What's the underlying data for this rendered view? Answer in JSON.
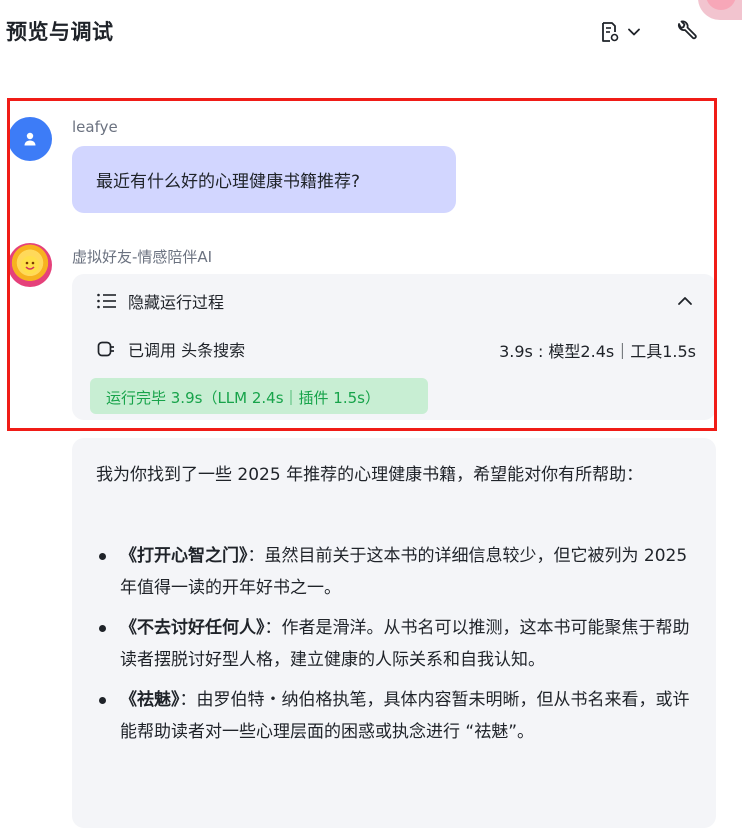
{
  "header": {
    "title": "预览与调试",
    "translate_badge": "A"
  },
  "messages": {
    "user": {
      "name": "leafye",
      "text": "最近有什么好的心理健康书籍推荐?"
    },
    "bot": {
      "name": "虚拟好友-情感陪伴AI",
      "process": {
        "toggle_label": "隐藏运行过程",
        "tool_used": "已调用 头条搜索",
        "timing": "3.9s : 模型2.4s｜工具1.5s",
        "done_badge": "运行完毕 3.9s（LLM 2.4s｜插件 1.5s）"
      },
      "answer": {
        "intro": "我为你找到了一些 2025 年推荐的心理健康书籍，希望能对你有所帮助：",
        "books": [
          {
            "title": "《打开心智之门》",
            "desc": "：虽然目前关于这本书的详细信息较少，但它被列为 2025 年值得一读的开年好书之一。"
          },
          {
            "title": "《不去讨好任何人》",
            "desc": "：作者是滑洋。从书名可以推测，这本书可能聚焦于帮助读者摆脱讨好型人格，建立健康的人际关系和自我认知。"
          },
          {
            "title": "《祛魅》",
            "desc": "：由罗伯特・纳伯格执笔，具体内容暂未明晰，但从书名来看，或许能帮助读者对一些心理层面的困惑或执念进行 “祛魅”。"
          }
        ]
      }
    }
  },
  "colors": {
    "user_avatar": "#3d7cf7",
    "user_bubble": "#d2d6ff",
    "card_bg": "#f4f5f8",
    "done_badge_bg": "#c8eed3",
    "done_badge_text": "#17a34a",
    "highlight_border": "#f01c17"
  },
  "icons": {
    "doc": "document-settings-icon",
    "dropdown": "chevron-down-icon",
    "wrench": "wrench-icon",
    "user_avatar": "person-icon",
    "list": "list-icon",
    "collapse": "chevron-up-icon",
    "tool": "plugin-icon"
  }
}
